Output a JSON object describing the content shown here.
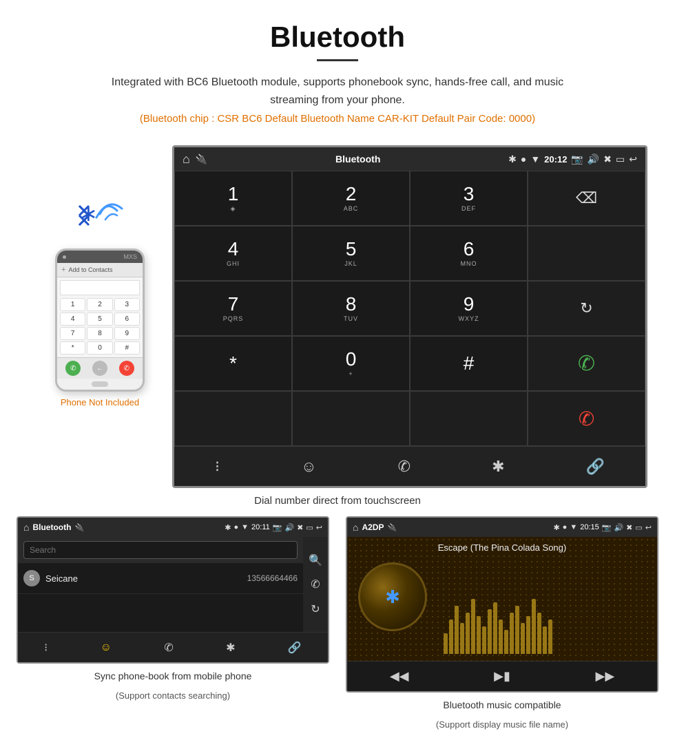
{
  "header": {
    "title": "Bluetooth",
    "description": "Integrated with BC6 Bluetooth module, supports phonebook sync, hands-free call, and music streaming from your phone.",
    "chip_info": "(Bluetooth chip : CSR BC6    Default Bluetooth Name CAR-KIT    Default Pair Code: 0000)"
  },
  "main_screen": {
    "status_bar": {
      "title": "Bluetooth",
      "time": "20:12",
      "icons": [
        "home",
        "usb",
        "bluetooth",
        "location",
        "wifi",
        "camera",
        "volume",
        "close",
        "window",
        "back"
      ]
    },
    "dialpad": {
      "keys": [
        {
          "num": "1",
          "sub": ""
        },
        {
          "num": "2",
          "sub": "ABC"
        },
        {
          "num": "3",
          "sub": "DEF"
        },
        {
          "num": "",
          "sub": ""
        },
        {
          "num": "4",
          "sub": "GHI"
        },
        {
          "num": "5",
          "sub": "JKL"
        },
        {
          "num": "6",
          "sub": "MNO"
        },
        {
          "num": "",
          "sub": ""
        },
        {
          "num": "7",
          "sub": "PQRS"
        },
        {
          "num": "8",
          "sub": "TUV"
        },
        {
          "num": "9",
          "sub": "WXYZ"
        },
        {
          "num": "",
          "sub": ""
        },
        {
          "num": "*",
          "sub": ""
        },
        {
          "num": "0",
          "sub": "+"
        },
        {
          "num": "#",
          "sub": ""
        },
        {
          "num": "",
          "sub": ""
        }
      ]
    }
  },
  "phone_side": {
    "not_included": "Phone Not Included"
  },
  "caption_main": "Dial number direct from touchscreen",
  "phonebook_screen": {
    "status_bar": {
      "title": "Bluetooth",
      "time": "20:11"
    },
    "search_placeholder": "Search",
    "contacts": [
      {
        "letter": "S",
        "name": "Seicane",
        "number": "13566664466"
      }
    ]
  },
  "music_screen": {
    "status_bar": {
      "title": "A2DP",
      "time": "20:15"
    },
    "song_title": "Escape (The Pina Colada Song)",
    "visualizer_heights": [
      30,
      50,
      70,
      45,
      60,
      80,
      55,
      40,
      65,
      75,
      50,
      35,
      60,
      70,
      45,
      55,
      80,
      60,
      40,
      50
    ]
  },
  "bottom_captions": {
    "phonebook": {
      "main": "Sync phone-book from mobile phone",
      "sub": "(Support contacts searching)"
    },
    "music": {
      "main": "Bluetooth music compatible",
      "sub": "(Support display music file name)"
    }
  },
  "nav_icons": {
    "grid": "⊞",
    "person": "👤",
    "phone": "📞",
    "bluetooth": "✱",
    "link": "🔗"
  }
}
